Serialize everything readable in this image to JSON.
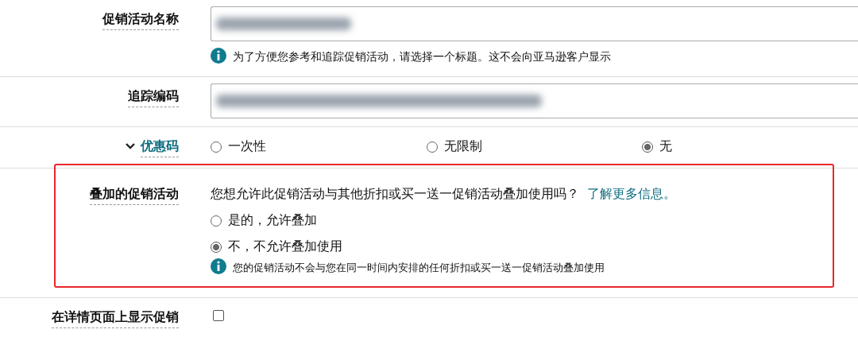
{
  "rows": [
    {
      "kind": "input",
      "label": "促销活动名称",
      "hint": "为了方便您参考和追踪促销活动，请选择一个标题。这不会向亚马逊客户显示"
    },
    {
      "kind": "input",
      "label": "追踪编码"
    },
    {
      "kind": "code",
      "label": "优惠码",
      "expanded": true,
      "options": [
        {
          "label": "一次性",
          "selected": false
        },
        {
          "label": "无限制",
          "selected": false
        },
        {
          "label": "无",
          "selected": true
        }
      ]
    },
    {
      "kind": "stack",
      "label": "叠加的促销活动",
      "highlighted": true,
      "question": "您想允许此促销活动与其他折扣或买一送一促销活动叠加使用吗？",
      "link": "了解更多信息。",
      "options": [
        {
          "label": "是的，允许叠加",
          "selected": false
        },
        {
          "label": "不，不允许叠加使用",
          "selected": true
        }
      ],
      "hint": "您的促销活动不会与您在同一时间内安排的任何折扣或买一送一促销活动叠加使用"
    },
    {
      "kind": "checkbox",
      "label": "在详情页面上显示促销",
      "checked": false
    }
  ]
}
